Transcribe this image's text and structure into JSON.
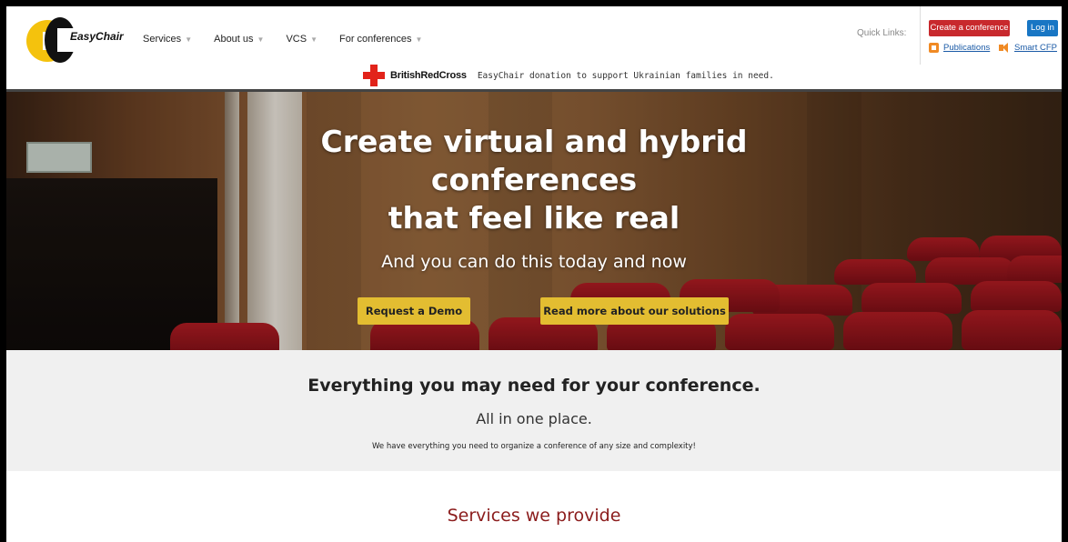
{
  "header": {
    "logo_text": "EasyChair",
    "nav": [
      {
        "label": "Services"
      },
      {
        "label": "About us"
      },
      {
        "label": "VCS"
      },
      {
        "label": "For conferences"
      }
    ],
    "quick_links_label": "Quick Links:",
    "create_conference_label": "Create a conference",
    "login_label": "Log in",
    "publications_label": "Publications",
    "smart_cfp_label": "Smart CFP"
  },
  "banner": {
    "partner_name": "BritishRedCross",
    "text": "EasyChair donation to support Ukrainian families in need."
  },
  "hero": {
    "title_line1": "Create virtual and hybrid",
    "title_line2": "conferences",
    "title_line3": "that feel like real",
    "subtitle": "And you can do this today and now",
    "demo_button": "Request a Demo",
    "read_more_button": "Read more about our solutions"
  },
  "features": {
    "title": "Everything you may need for your conference.",
    "subtitle": "All in one place.",
    "description": "We have everything you need to organize a conference of any size and complexity!"
  },
  "services_heading": "Services we provide",
  "colors": {
    "create_button": "#c8292d",
    "login_button": "#1876c4",
    "hero_button": "#e3bd31",
    "services_heading": "#8b1c1c"
  }
}
